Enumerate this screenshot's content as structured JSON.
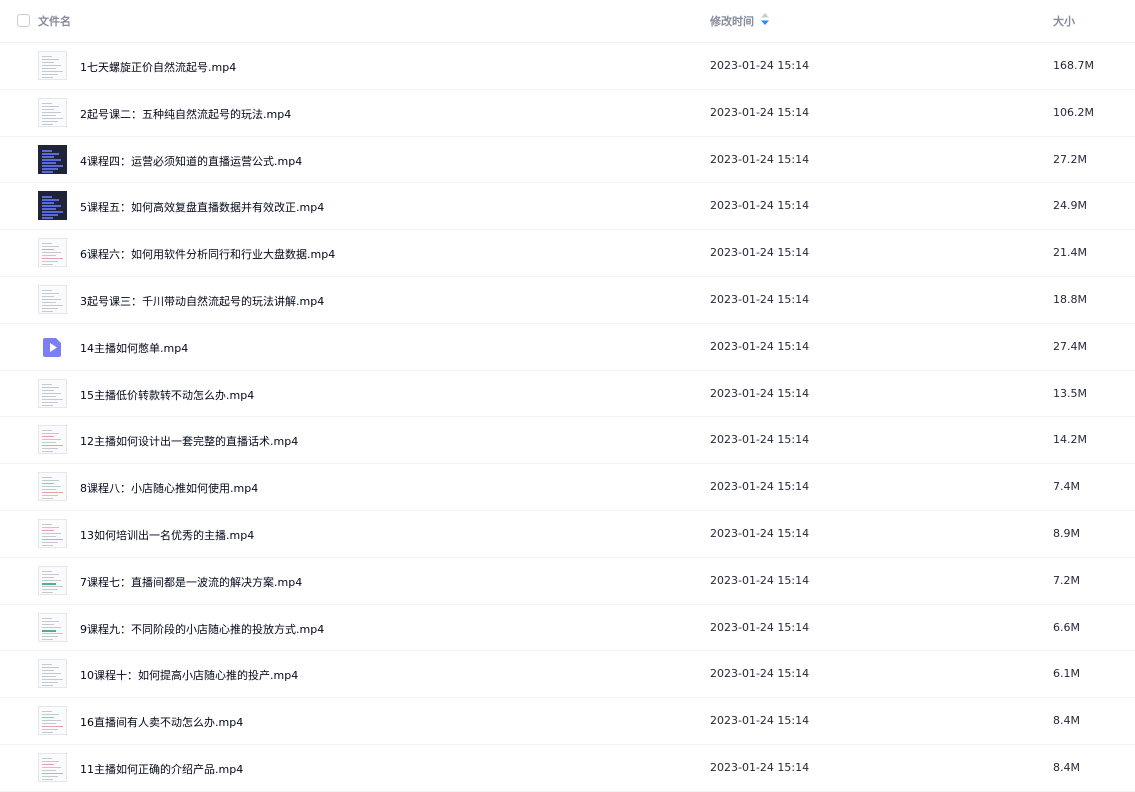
{
  "header": {
    "name_label": "文件名",
    "time_label": "修改时间",
    "size_label": "大小"
  },
  "files": [
    {
      "name": "1七天螺旋正价自然流起号.mp4",
      "time": "2023-01-24 15:14",
      "size": "168.7M",
      "thumb": "doc"
    },
    {
      "name": "2起号课二：五种纯自然流起号的玩法.mp4",
      "time": "2023-01-24 15:14",
      "size": "106.2M",
      "thumb": "doc"
    },
    {
      "name": "4课程四：运营必须知道的直播运营公式.mp4",
      "time": "2023-01-24 15:14",
      "size": "27.2M",
      "thumb": "dark"
    },
    {
      "name": "5课程五：如何高效复盘直播数据并有效改正.mp4",
      "time": "2023-01-24 15:14",
      "size": "24.9M",
      "thumb": "dark"
    },
    {
      "name": "6课程六：如何用软件分析同行和行业大盘数据.mp4",
      "time": "2023-01-24 15:14",
      "size": "21.4M",
      "thumb": "red"
    },
    {
      "name": "3起号课三：千川带动自然流起号的玩法讲解.mp4",
      "time": "2023-01-24 15:14",
      "size": "18.8M",
      "thumb": "doc"
    },
    {
      "name": "14主播如何憋单.mp4",
      "time": "2023-01-24 15:14",
      "size": "27.4M",
      "thumb": "play"
    },
    {
      "name": "15主播低价转款转不动怎么办.mp4",
      "time": "2023-01-24 15:14",
      "size": "13.5M",
      "thumb": "doc"
    },
    {
      "name": "12主播如何设计出一套完整的直播话术.mp4",
      "time": "2023-01-24 15:14",
      "size": "14.2M",
      "thumb": "red"
    },
    {
      "name": "8课程八：小店随心推如何使用.mp4",
      "time": "2023-01-24 15:14",
      "size": "7.4M",
      "thumb": "red"
    },
    {
      "name": "13如何培训出一名优秀的主播.mp4",
      "time": "2023-01-24 15:14",
      "size": "8.9M",
      "thumb": "red"
    },
    {
      "name": "7课程七：直播间都是一波流的解决方案.mp4",
      "time": "2023-01-24 15:14",
      "size": "7.2M",
      "thumb": "green"
    },
    {
      "name": "9课程九：不同阶段的小店随心推的投放方式.mp4",
      "time": "2023-01-24 15:14",
      "size": "6.6M",
      "thumb": "green"
    },
    {
      "name": "10课程十：如何提高小店随心推的投产.mp4",
      "time": "2023-01-24 15:14",
      "size": "6.1M",
      "thumb": "doc"
    },
    {
      "name": "16直播间有人卖不动怎么办.mp4",
      "time": "2023-01-24 15:14",
      "size": "8.4M",
      "thumb": "red"
    },
    {
      "name": "11主播如何正确的介绍产品.mp4",
      "time": "2023-01-24 15:14",
      "size": "8.4M",
      "thumb": "red"
    }
  ],
  "colors": {
    "sort_arrow_active": "#2b8cf5",
    "sort_arrow_inactive": "#c7ccd6",
    "play_icon_bg": "#7b7ff5"
  }
}
